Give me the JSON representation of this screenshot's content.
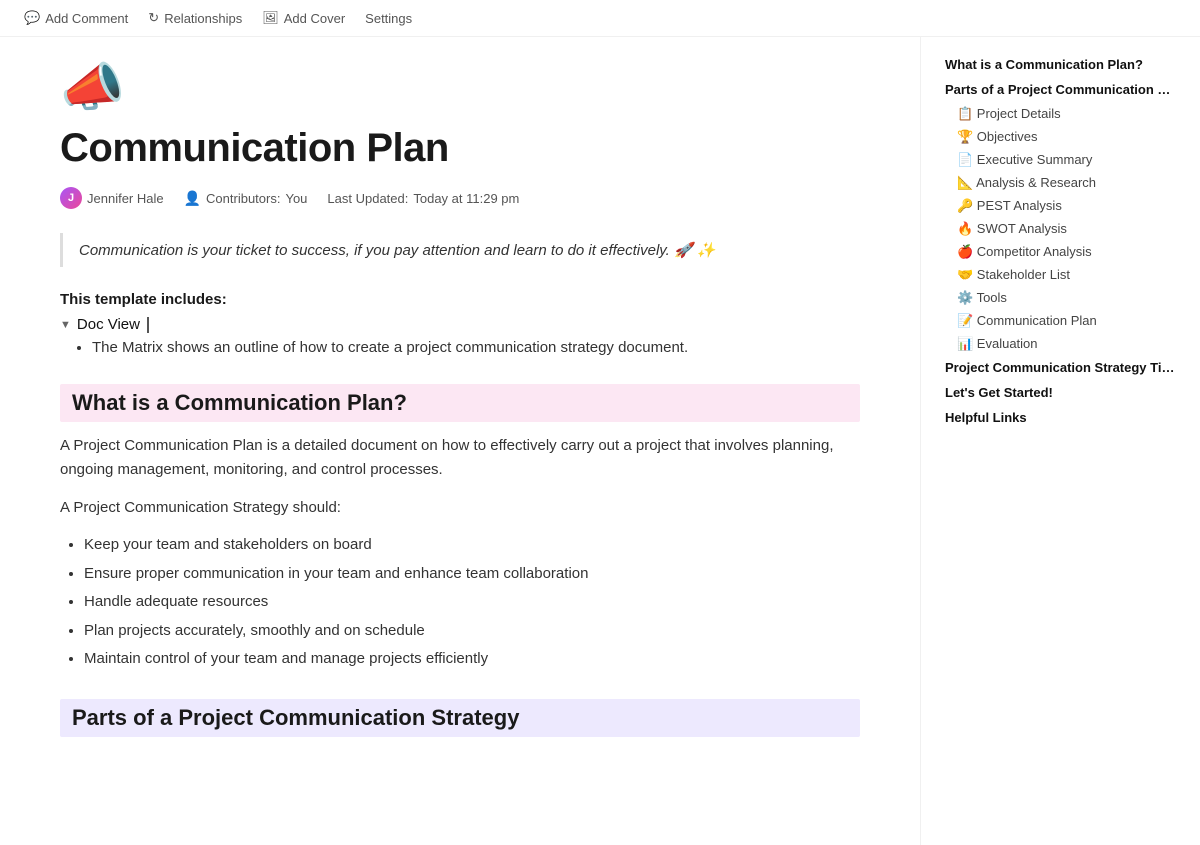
{
  "toolbar": {
    "add_comment_label": "Add Comment",
    "relationships_label": "Relationships",
    "add_cover_label": "Add Cover",
    "settings_label": "Settings"
  },
  "page": {
    "icon": "📣",
    "title": "Communication Plan",
    "author": "Jennifer Hale",
    "contributors_label": "Contributors:",
    "contributors_value": "You",
    "last_updated_label": "Last Updated:",
    "last_updated_value": "Today at 11:29 pm",
    "quote": "Communication is your ticket to success, if you pay attention and learn to do it effectively. 🚀 ✨",
    "template_heading": "This template includes:",
    "doc_view_label": "Doc View",
    "bullet_1": "The Matrix shows an outline of how to create a project communication strategy document.",
    "section1_heading": "What is a Communication Plan?",
    "section1_p1": "A Project Communication Plan is a detailed document on how to effectively carry out a project that involves planning, ongoing management, monitoring, and control processes.",
    "section1_strategy_intro": "A Project Communication Strategy should:",
    "section1_bullets": [
      "Keep your team and stakeholders on board",
      "Ensure proper communication in your team and enhance team collaboration",
      "Handle adequate resources",
      "Plan projects accurately, smoothly and on schedule",
      "Maintain control of your team and manage projects efficiently"
    ],
    "section2_heading": "Parts of a Project Communication Strategy"
  },
  "toc": {
    "items": [
      {
        "label": "What is a Communication Plan?",
        "type": "top"
      },
      {
        "label": "Parts of a Project Communication St...",
        "type": "top"
      },
      {
        "icon": "📋",
        "label": "Project Details",
        "type": "sub"
      },
      {
        "icon": "🏆",
        "label": "Objectives",
        "type": "sub"
      },
      {
        "icon": "📄",
        "label": "Executive Summary",
        "type": "sub"
      },
      {
        "icon": "📐",
        "label": "Analysis & Research",
        "type": "sub"
      },
      {
        "icon": "🔑",
        "label": "PEST Analysis",
        "type": "sub"
      },
      {
        "icon": "🔥",
        "label": "SWOT Analysis",
        "type": "sub"
      },
      {
        "icon": "🍎",
        "label": "Competitor Analysis",
        "type": "sub"
      },
      {
        "icon": "🤝",
        "label": "Stakeholder List",
        "type": "sub"
      },
      {
        "icon": "⚙️",
        "label": "Tools",
        "type": "sub"
      },
      {
        "icon": "📝",
        "label": "Communication Plan",
        "type": "sub"
      },
      {
        "icon": "📊",
        "label": "Evaluation",
        "type": "sub"
      },
      {
        "label": "Project Communication Strategy Tips!",
        "type": "top"
      },
      {
        "label": "Let's Get Started!",
        "type": "top"
      },
      {
        "label": "Helpful Links",
        "type": "top"
      }
    ]
  }
}
